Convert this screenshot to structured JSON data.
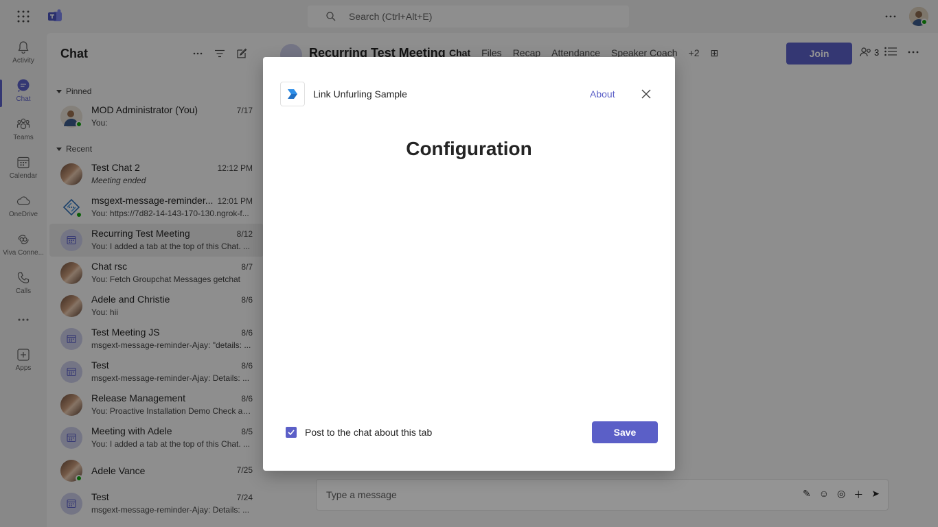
{
  "topbar": {
    "search_placeholder": "Search (Ctrl+Alt+E)"
  },
  "rail": {
    "items": [
      {
        "label": "Activity",
        "icon": "bell-icon"
      },
      {
        "label": "Chat",
        "icon": "chat-icon",
        "active": true
      },
      {
        "label": "Teams",
        "icon": "teams-icon"
      },
      {
        "label": "Calendar",
        "icon": "calendar-icon"
      },
      {
        "label": "OneDrive",
        "icon": "cloud-icon"
      },
      {
        "label": "Viva Conne...",
        "icon": "viva-icon"
      },
      {
        "label": "Calls",
        "icon": "phone-icon"
      },
      {
        "label": "Apps",
        "icon": "add-apps-icon"
      }
    ]
  },
  "chatpanel": {
    "title": "Chat",
    "pinned_label": "Pinned",
    "recent_label": "Recent",
    "pinned": [
      {
        "name": "MOD Administrator (You)",
        "time": "7/17",
        "preview": "You:"
      }
    ],
    "recent": [
      {
        "name": "Test Chat 2",
        "time": "12:12 PM",
        "preview": "Meeting ended"
      },
      {
        "name": "msgext-message-reminder...",
        "time": "12:01 PM",
        "preview": "You: https://7d82-14-143-170-130.ngrok-f..."
      },
      {
        "name": "Recurring Test Meeting",
        "time": "8/12",
        "preview": "You: I added a tab at the top of this Chat. ..."
      },
      {
        "name": "Chat rsc",
        "time": "8/7",
        "preview": "You: Fetch Groupchat Messages getchat"
      },
      {
        "name": "Adele and Christie",
        "time": "8/6",
        "preview": "You: hii"
      },
      {
        "name": "Test Meeting JS",
        "time": "8/6",
        "preview": "msgext-message-reminder-Ajay: \"details: ..."
      },
      {
        "name": "Test",
        "time": "8/6",
        "preview": "msgext-message-reminder-Ajay: Details: ..."
      },
      {
        "name": "Release Management",
        "time": "8/6",
        "preview": "You: Proactive Installation Demo Check an..."
      },
      {
        "name": "Meeting with Adele",
        "time": "8/5",
        "preview": "You: I added a tab at the top of this Chat. ..."
      },
      {
        "name": "Adele Vance",
        "time": "7/25",
        "preview": ""
      },
      {
        "name": "Test",
        "time": "7/24",
        "preview": "msgext-message-reminder-Ajay: Details: ..."
      }
    ]
  },
  "main": {
    "title": "Recurring Test Meeting",
    "tabs": [
      "Chat",
      "Files",
      "Recap",
      "Attendance",
      "Speaker Coach",
      "+2"
    ],
    "join_label": "Join",
    "participants_count": "3",
    "composer_placeholder": "Type a message"
  },
  "dialog": {
    "app_name": "Link Unfurling Sample",
    "about_label": "About",
    "heading": "Configuration",
    "checkbox_label": "Post to the chat about this tab",
    "checkbox_checked": true,
    "save_label": "Save"
  },
  "colors": {
    "accent": "#5b5fc7",
    "presence": "#13a10e"
  }
}
